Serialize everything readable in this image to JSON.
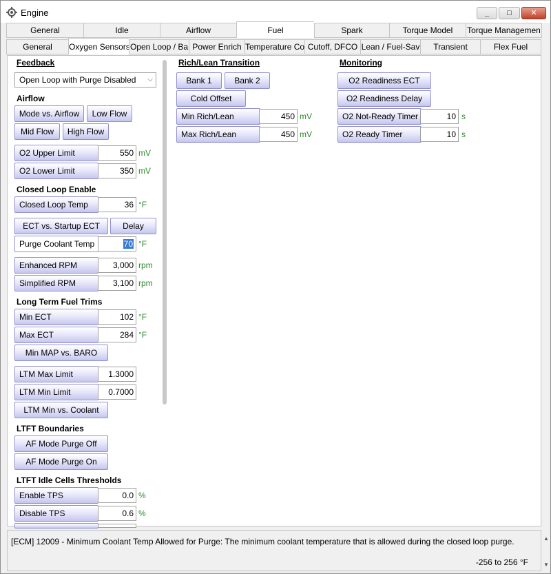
{
  "window": {
    "title": "Engine",
    "icon": "gear-icon"
  },
  "tabs_main": [
    "General",
    "Idle",
    "Airflow",
    "Fuel",
    "Spark",
    "Torque Model",
    "Torque Managemen"
  ],
  "tabs_sub": [
    "General",
    "Oxygen Sensors",
    "Open Loop / Ba",
    "Power Enrich",
    "Temperature Co",
    "Cutoff, DFCO",
    "Lean / Fuel-Sav",
    "Transient",
    "Flex Fuel"
  ],
  "left": {
    "feedback_heading": "Feedback",
    "feedback_dropdown": "Open Loop with Purge Disabled",
    "airflow_heading": "Airflow",
    "btn_mode_vs_airflow": "Mode vs. Airflow",
    "btn_low_flow": "Low Flow",
    "btn_mid_flow": "Mid Flow",
    "btn_high_flow": "High Flow",
    "o2_upper_label": "O2 Upper Limit",
    "o2_upper_value": "550",
    "o2_upper_unit": "mV",
    "o2_lower_label": "O2 Lower Limit",
    "o2_lower_value": "350",
    "o2_lower_unit": "mV",
    "closed_loop_heading": "Closed Loop Enable",
    "cl_temp_label": "Closed Loop Temp",
    "cl_temp_value": "36",
    "cl_temp_unit": "°F",
    "btn_ect_vs_startup": "ECT vs. Startup ECT",
    "btn_delay": "Delay",
    "purge_label": "Purge Coolant Temp",
    "purge_value": "70",
    "purge_unit": "°F",
    "enh_rpm_label": "Enhanced RPM",
    "enh_rpm_value": "3,000",
    "enh_rpm_unit": "rpm",
    "simp_rpm_label": "Simplified RPM",
    "simp_rpm_value": "3,100",
    "simp_rpm_unit": "rpm",
    "ltft_heading": "Long Term Fuel Trims",
    "min_ect_label": "Min ECT",
    "min_ect_value": "102",
    "min_ect_unit": "°F",
    "max_ect_label": "Max ECT",
    "max_ect_value": "284",
    "max_ect_unit": "°F",
    "btn_min_map": "Min MAP vs. BARO",
    "ltm_max_label": "LTM Max Limit",
    "ltm_max_value": "1.3000",
    "ltm_min_label": "LTM Min Limit",
    "ltm_min_value": "0.7000",
    "btn_ltm_min_coolant": "LTM Min vs. Coolant",
    "ltft_boundaries_heading": "LTFT Boundaries",
    "btn_af_purge_off": "AF Mode Purge Off",
    "btn_af_purge_on": "AF Mode Purge On",
    "ltft_idle_heading": "LTFT Idle Cells Thresholds",
    "enable_tps_label": "Enable TPS",
    "enable_tps_value": "0.0",
    "enable_tps_unit": "%",
    "disable_tps_label": "Disable TPS",
    "disable_tps_value": "0.6",
    "disable_tps_unit": "%"
  },
  "middle": {
    "heading": "Rich/Lean Transition",
    "btn_bank1": "Bank 1",
    "btn_bank2": "Bank 2",
    "btn_cold_offset": "Cold Offset",
    "min_rl_label": "Min Rich/Lean",
    "min_rl_value": "450",
    "min_rl_unit": "mV",
    "max_rl_label": "Max Rich/Lean",
    "max_rl_value": "450",
    "max_rl_unit": "mV"
  },
  "right": {
    "heading": "Monitoring",
    "btn_readiness_ect": "O2 Readiness ECT",
    "btn_readiness_delay": "O2 Readiness Delay",
    "not_ready_label": "O2 Not-Ready Timer",
    "not_ready_value": "10",
    "not_ready_unit": "s",
    "ready_label": "O2 Ready Timer",
    "ready_value": "10",
    "ready_unit": "s"
  },
  "status": {
    "description": "[ECM] 12009 - Minimum Coolant Temp Allowed for Purge: The minimum coolant temperature that is allowed during the closed loop purge.",
    "range": "-256 to 256 °F"
  }
}
